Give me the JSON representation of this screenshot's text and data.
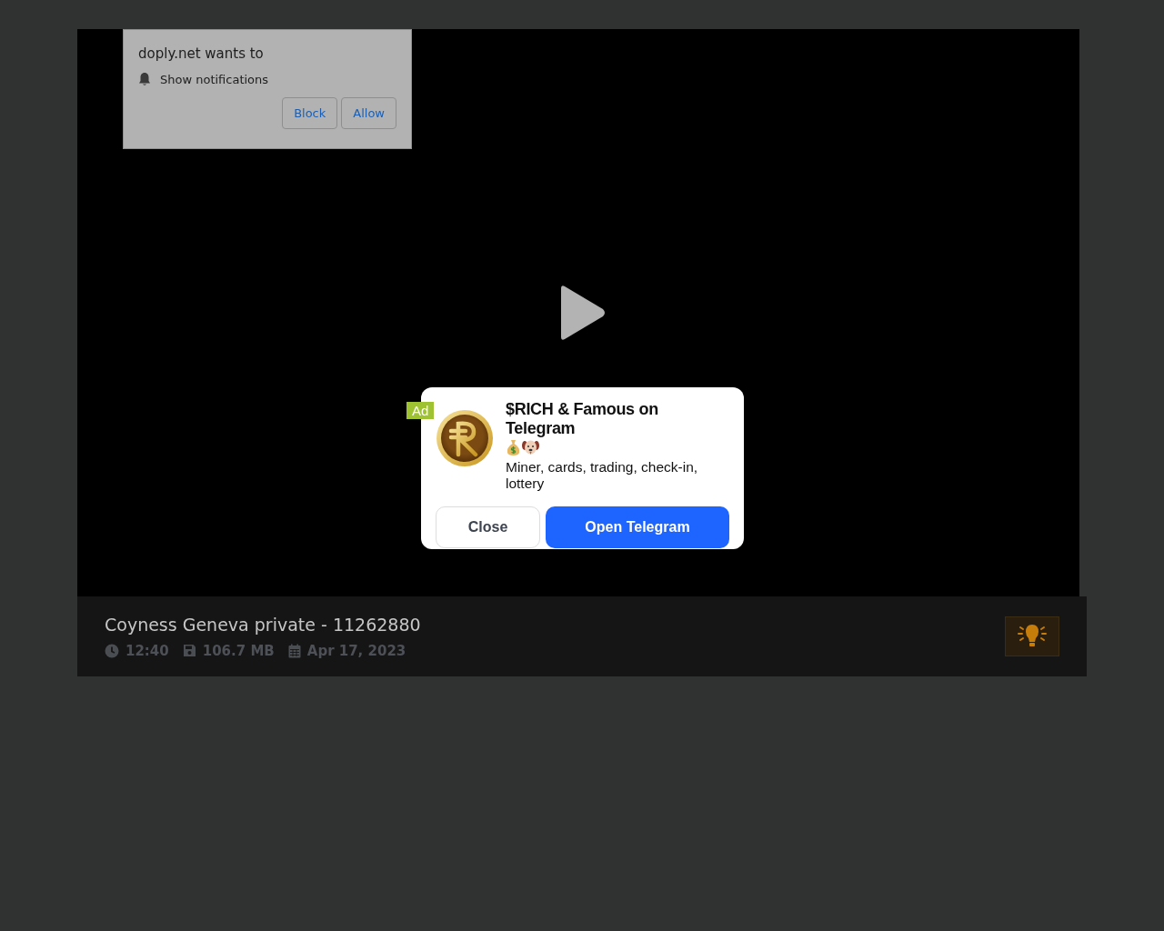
{
  "permission_prompt": {
    "message": "doply.net wants to",
    "permission": "Show notifications",
    "buttons": [
      "Block",
      "Allow"
    ]
  },
  "ad": {
    "badge": "Ad",
    "title": "$RICH & Famous on Telegram",
    "description": "Miner, cards, trading, check-in, lottery",
    "close_button": "Close",
    "action_button": "Open Telegram"
  },
  "video": {
    "title": "Coyness Geneva private - 11262880",
    "duration": "12:40",
    "size": "106.7 MB",
    "date": "Apr 17, 2023"
  }
}
